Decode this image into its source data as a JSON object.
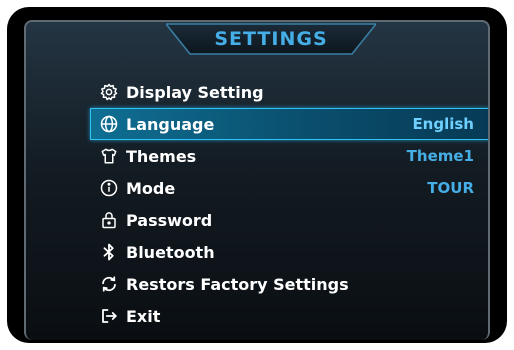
{
  "header": {
    "title": "SETTINGS"
  },
  "menu": {
    "items": [
      {
        "label": "Display Setting",
        "icon": "gear-icon",
        "value": ""
      },
      {
        "label": "Language",
        "icon": "globe-icon",
        "value": "English",
        "selected": true
      },
      {
        "label": "Themes",
        "icon": "shirt-icon",
        "value": "Theme1"
      },
      {
        "label": "Mode",
        "icon": "info-icon",
        "value": "TOUR"
      },
      {
        "label": "Password",
        "icon": "lock-icon",
        "value": ""
      },
      {
        "label": "Bluetooth",
        "icon": "bluetooth-icon",
        "value": ""
      },
      {
        "label": "Restors Factory Settings",
        "icon": "refresh-icon",
        "value": ""
      },
      {
        "label": "Exit",
        "icon": "exit-icon",
        "value": ""
      }
    ]
  },
  "colors": {
    "accent": "#46aee6",
    "highlight": "#0f6f93",
    "highlight_border": "#2ec3f0",
    "text": "#ffffff",
    "bezel": "#000000"
  }
}
